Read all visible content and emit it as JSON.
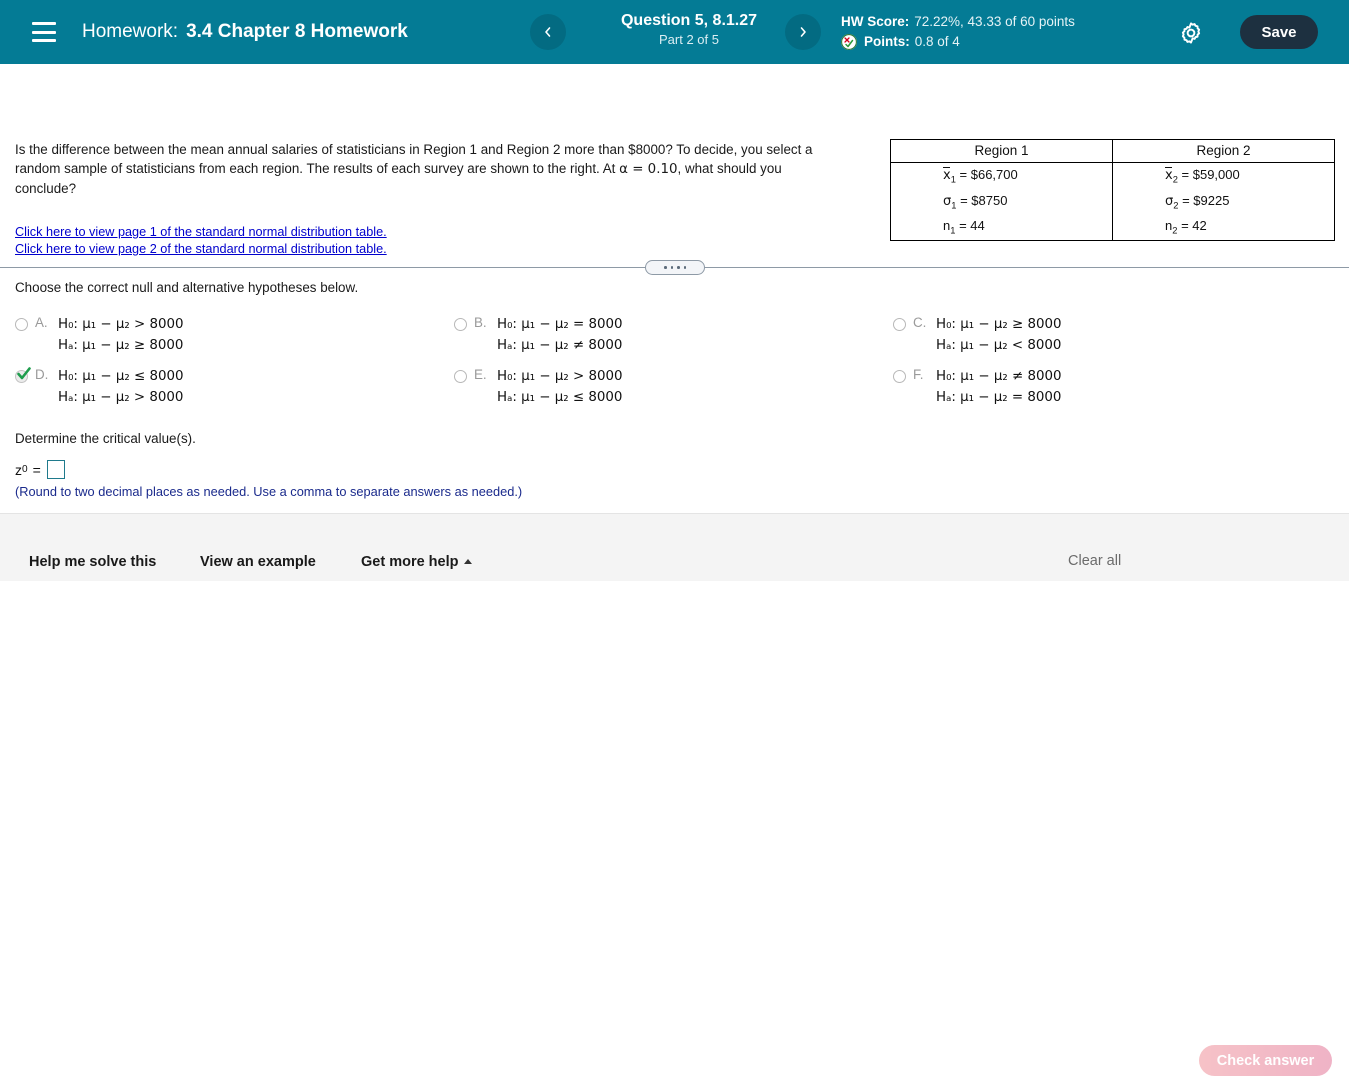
{
  "header": {
    "menu_icon": "hamburger-icon",
    "homework_label": "Homework:",
    "homework_title": "3.4 Chapter 8 Homework",
    "prev_icon": "chevron-left-icon",
    "next_icon": "chevron-right-icon",
    "question_title": "Question 5, 8.1.27",
    "question_part": "Part 2 of 5",
    "hw_score_label": "HW Score:",
    "hw_score_value": "72.22%, 43.33 of 60 points",
    "points_label": "Points:",
    "points_value": "0.8 of 4",
    "points_icon": "partial-credit-icon",
    "gear_icon": "gear-icon",
    "save_label": "Save",
    "bg_color": "#047b95",
    "save_bg_color": "#1d3040"
  },
  "problem": {
    "text_line1": "Is the difference between the mean annual salaries of statisticians in Region 1 and Region 2 more than $8000? To decide, you select a",
    "text_line2_a": "random sample of statisticians from each region. The results of each survey are shown to the right. At ",
    "text_line2_alpha": "α = 0.10",
    "text_line2_b": ", what should you conclude?"
  },
  "data_table": {
    "headers": [
      "Region 1",
      "Region 2"
    ],
    "rows": [
      {
        "c1_sym": "x",
        "c1_sub": "1",
        "c1_val": "= $66,700",
        "c2_sym": "x",
        "c2_sub": "2",
        "c2_val": "= $59,000",
        "overbar": true
      },
      {
        "c1_sym": "σ",
        "c1_sub": "1",
        "c1_val": "= $8750",
        "c2_sym": "σ",
        "c2_sub": "2",
        "c2_val": "= $9225",
        "overbar": false
      },
      {
        "c1_sym": "n",
        "c1_sub": "1",
        "c1_val": "= 44",
        "c2_sym": "n",
        "c2_sub": "2",
        "c2_val": "= 42",
        "overbar": false
      }
    ]
  },
  "links": {
    "page1": "Click here to view page 1 of the standard normal distribution table.",
    "page2": "Click here to view page 2 of the standard normal distribution table."
  },
  "divider": {
    "handle_icon": "drag-handle-dots-icon",
    "dots": 4
  },
  "question": {
    "instruction": "Choose the correct null and alternative hypotheses below.",
    "options": [
      {
        "letter": "A.",
        "h0": "H₀: μ₁ − μ₂ > 8000",
        "ha": "Hₐ: μ₁ − μ₂ ≥ 8000",
        "null_op": ">",
        "alt_op": "≥",
        "selected": false
      },
      {
        "letter": "B.",
        "h0": "H₀: μ₁ − μ₂ = 8000",
        "ha": "Hₐ: μ₁ − μ₂ ≠ 8000",
        "null_op": "=",
        "alt_op": "≠",
        "selected": false
      },
      {
        "letter": "C.",
        "h0": "H₀: μ₁ − μ₂ ≥ 8000",
        "ha": "Hₐ: μ₁ − μ₂ < 8000",
        "null_op": "≥",
        "alt_op": "<",
        "selected": false
      },
      {
        "letter": "D.",
        "h0": "H₀: μ₁ − μ₂ ≤ 8000",
        "ha": "Hₐ: μ₁ − μ₂ > 8000",
        "null_op": "≤",
        "alt_op": ">",
        "selected": true
      },
      {
        "letter": "E.",
        "h0": "H₀: μ₁ − μ₂ > 8000",
        "ha": "Hₐ: μ₁ − μ₂ ≤ 8000",
        "null_op": ">",
        "alt_op": "≤",
        "selected": false
      },
      {
        "letter": "F.",
        "h0": "H₀: μ₁ − μ₂ ≠ 8000",
        "ha": "Hₐ: μ₁ − μ₂ = 8000",
        "null_op": "≠",
        "alt_op": "=",
        "selected": false
      }
    ],
    "value_8000": "8000",
    "check_color": "#1f9d4d"
  },
  "critical_value": {
    "prompt": "Determine the critical value(s).",
    "symbol": "z",
    "subscript": "0",
    "equals": "=",
    "input_value": "",
    "input_placeholder": "",
    "note": "(Round to two decimal places as needed. Use a comma to separate answers as needed.)",
    "input_border_color": "#1f7a8c"
  },
  "footer": {
    "help_me_solve": "Help me solve this",
    "view_example": "View an example",
    "get_more_help": "Get more help",
    "get_more_help_icon": "caret-up-icon",
    "clear_all": "Clear all",
    "check_answer": "Check answer",
    "bg_color": "#f4f4f4"
  }
}
